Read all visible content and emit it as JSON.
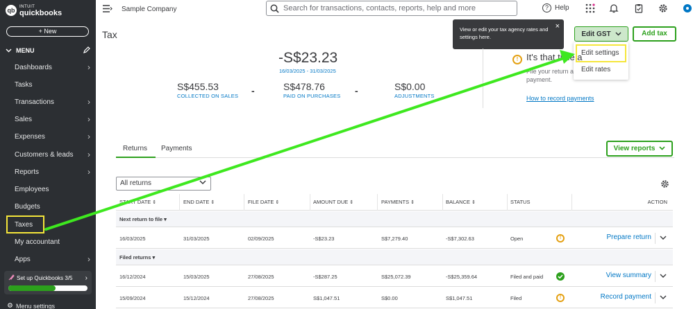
{
  "sidebar": {
    "logo_top": "INTUIT",
    "logo_brand": "quickbooks",
    "logo_badge": "qb",
    "new_label": "+ New",
    "menu_label": "MENU",
    "items": [
      {
        "label": "Dashboards",
        "arrow": true
      },
      {
        "label": "Tasks",
        "arrow": false
      },
      {
        "label": "Transactions",
        "arrow": true
      },
      {
        "label": "Sales",
        "arrow": true
      },
      {
        "label": "Expenses",
        "arrow": true
      },
      {
        "label": "Customers & leads",
        "arrow": true
      },
      {
        "label": "Reports",
        "arrow": true
      },
      {
        "label": "Employees",
        "arrow": false
      },
      {
        "label": "Budgets",
        "arrow": false
      },
      {
        "label": "Taxes",
        "arrow": false
      },
      {
        "label": "My accountant",
        "arrow": false
      },
      {
        "label": "Apps",
        "arrow": true
      }
    ],
    "setup_label": "Set up Quickbooks 3/5",
    "setup_progress": 0.6,
    "menu_settings_label": "Menu settings"
  },
  "topbar": {
    "company": "Sample Company",
    "search_placeholder": "Search for transactions, contacts, reports, help and more",
    "help_label": "Help"
  },
  "page": {
    "title": "Tax",
    "tooltip": "View or edit your tax agency rates and settings here.",
    "edit_gst_label": "Edit GST",
    "add_tax_label": "Add tax",
    "dropdown": [
      "Edit settings",
      "Edit rates"
    ]
  },
  "summary": {
    "net_amount": "-S$23.23",
    "period": "16/03/2025 - 31/03/2025",
    "collected_value": "S$455.53",
    "collected_label": "COLLECTED ON SALES",
    "paid_value": "S$478.76",
    "paid_label": "PAID ON PURCHASES",
    "adjustments_value": "S$0.00",
    "adjustments_label": "ADJUSTMENTS",
    "minus": "-"
  },
  "due": {
    "title": "It's that time a",
    "text": "File your return a\npayment.",
    "link": "How to record payments"
  },
  "tabs": [
    "Returns",
    "Payments"
  ],
  "view_reports_label": "View reports",
  "filter": {
    "selected": "All returns"
  },
  "table": {
    "columns": [
      "START DATE",
      "END DATE",
      "FILE DATE",
      "AMOUNT DUE",
      "PAYMENTS",
      "BALANCE",
      "STATUS",
      "ACTION"
    ],
    "groups": [
      {
        "label": "Next return to file",
        "rows": [
          {
            "start": "16/03/2025",
            "end": "31/03/2025",
            "file": "02/09/2025",
            "amount": "-S$23.23",
            "payments": "S$7,279.40",
            "balance": "-S$7,302.63",
            "status": "Open",
            "status_icon": "warning",
            "action": "Prepare return"
          }
        ]
      },
      {
        "label": "Filed returns",
        "rows": [
          {
            "start": "16/12/2024",
            "end": "15/03/2025",
            "file": "27/08/2025",
            "amount": "-S$287.25",
            "payments": "S$25,072.39",
            "balance": "-S$25,359.64",
            "status": "Filed and paid",
            "status_icon": "check",
            "action": "View summary"
          },
          {
            "start": "15/09/2024",
            "end": "15/12/2024",
            "file": "27/08/2025",
            "amount": "S$1,047.51",
            "payments": "S$0.00",
            "balance": "S$1,047.51",
            "status": "Filed",
            "status_icon": "warning",
            "action": "Record payment"
          }
        ]
      }
    ]
  },
  "colors": {
    "sidebar_bg": "#2c2f33",
    "brand_green": "#2ca01c",
    "link_blue": "#0077c5",
    "highlight_yellow": "#f5e63a",
    "warning_orange": "#e4a012",
    "annotation_arrow": "#3ee81f"
  }
}
